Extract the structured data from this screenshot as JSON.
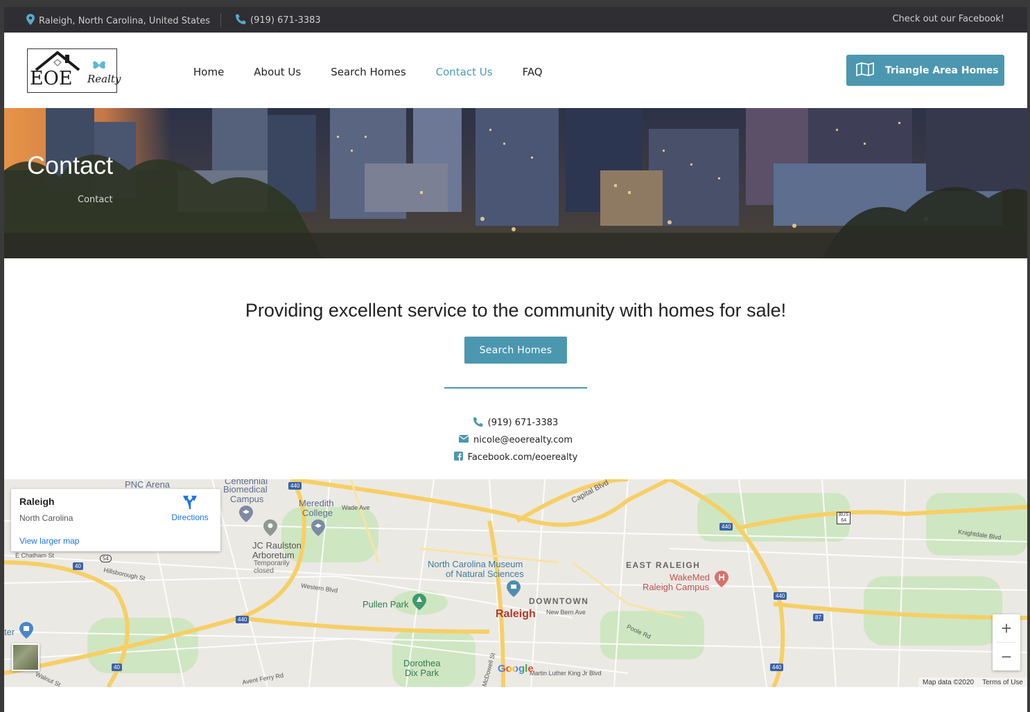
{
  "topbar": {
    "location": "Raleigh, North Carolina, United States",
    "phone": "(919) 671-3383",
    "facebook_link": "Check out our Facebook!"
  },
  "header": {
    "logo_main": "EOE",
    "logo_sub": "Realty",
    "nav": [
      {
        "label": "Home",
        "active": false
      },
      {
        "label": "About Us",
        "active": false
      },
      {
        "label": "Search Homes",
        "active": false
      },
      {
        "label": "Contact Us",
        "active": true
      },
      {
        "label": "FAQ",
        "active": false
      }
    ],
    "cta_label": "Triangle Area Homes",
    "cta_icon": "map-icon"
  },
  "hero": {
    "title": "Contact",
    "breadcrumb": "Contact"
  },
  "main": {
    "tagline": "Providing excellent service to the community with homes for sale!",
    "search_button": "Search Homes",
    "contacts": {
      "phone": "(919) 671-3383",
      "email": "nicole@eoerealty.com",
      "facebook": "Facebook.com/eoerealty"
    }
  },
  "map": {
    "card": {
      "place": "Raleigh",
      "region": "North Carolina",
      "directions": "Directions",
      "larger_map": "View larger map"
    },
    "labels": {
      "pnc": "PNC Arena",
      "centennial": "Centennial",
      "biomedical": "Biomedical",
      "campus": "Campus",
      "meredith": "Meredith",
      "college": "College",
      "jcr1": "JC Raulston",
      "jcr2": "Arboretum",
      "jcr3": "Temporarily",
      "jcr4": "closed",
      "ncm1": "North Carolina Museum",
      "ncm2": "of Natural Sciences",
      "pullen": "Pullen Park",
      "downtown": "DOWNTOWN",
      "raleigh": "Raleigh",
      "east": "EAST RALEIGH",
      "wakemed1": "WakeMed",
      "wakemed2": "Raleigh Campus",
      "dix1": "Dorothea",
      "dix2": "Dix Park",
      "capital": "Capital Blvd",
      "wade": "Wade Ave",
      "hillsborough": "Hillsborough St",
      "western": "Western Blvd",
      "newbern": "New Bern Ave",
      "poole": "Poole Rd",
      "chatham": "E Chatham St",
      "avent": "Avent Ferry Rd",
      "walnut": "Walnut St",
      "mlk": "Martin Luther King Jr Blvd",
      "mcdowell": "McDowell St",
      "knightdale": "Knightdale Blvd",
      "ter": "ter"
    },
    "shields": [
      "440",
      "440",
      "440",
      "440",
      "440",
      "40",
      "40",
      "40",
      "87",
      "54",
      "64"
    ],
    "shield_bus": "BUS",
    "zoom_in": "+",
    "zoom_out": "−",
    "google": "Google",
    "attribution": "Map data ©2020",
    "terms": "Terms of Use"
  }
}
